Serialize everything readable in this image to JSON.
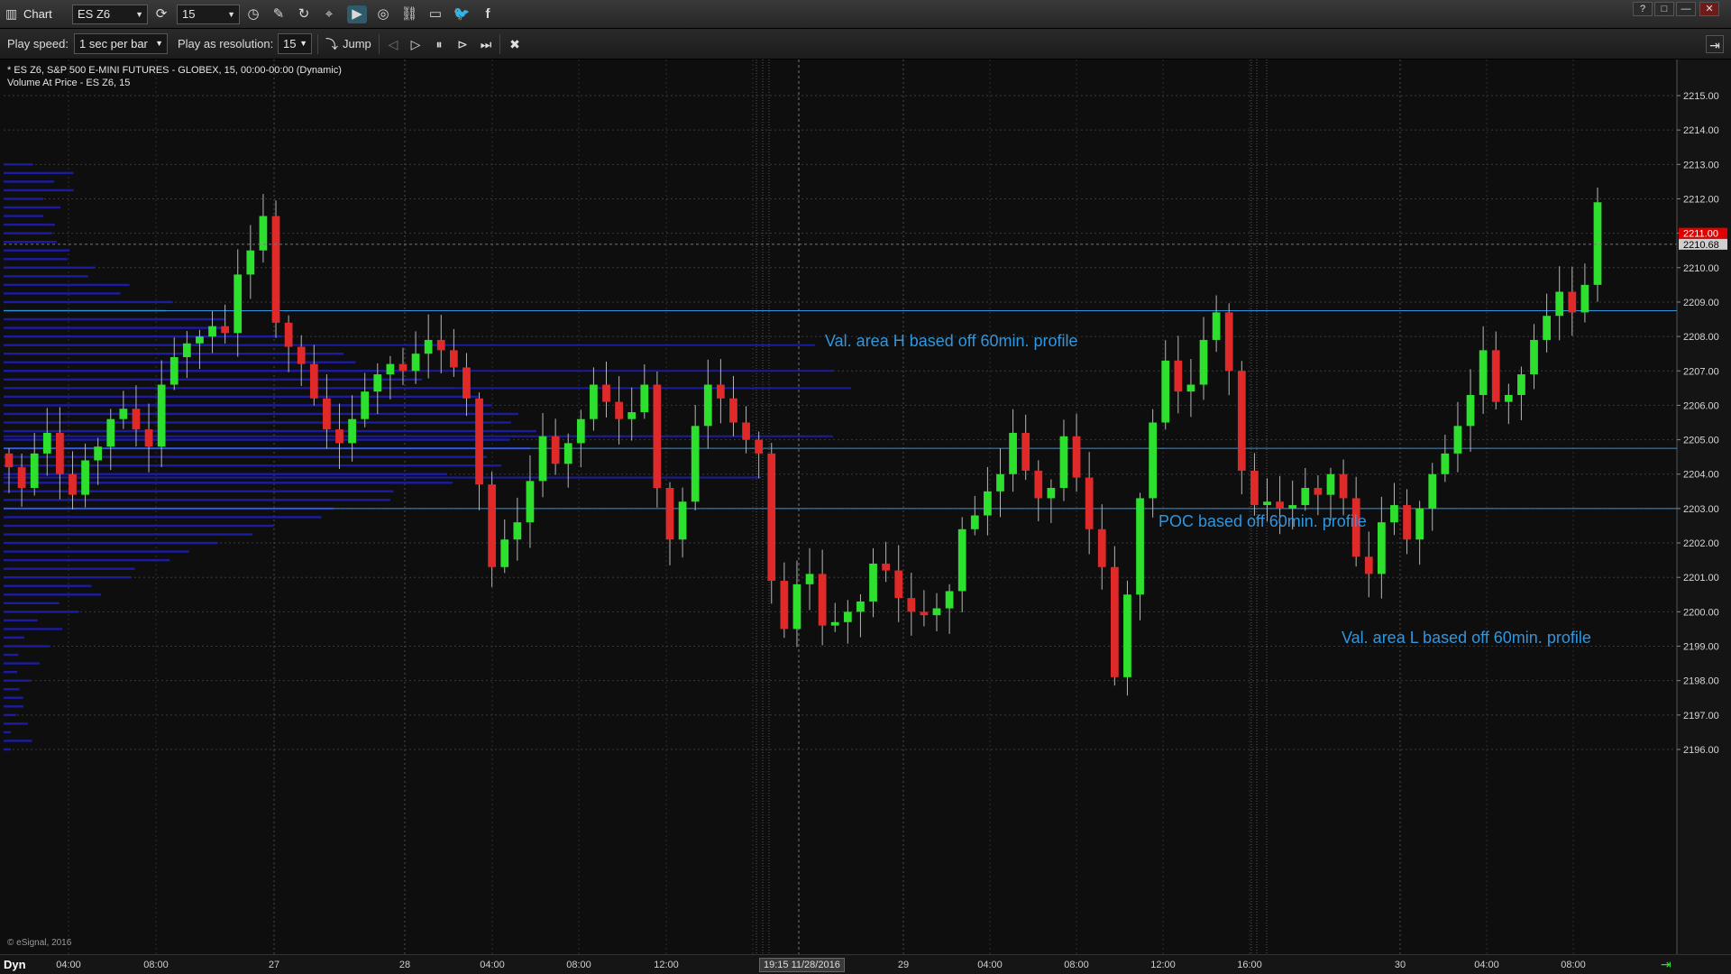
{
  "window": {
    "title": "Chart",
    "symbol": "ES Z6",
    "interval": "15",
    "buttons": [
      "?",
      "□",
      "—",
      "□",
      "✕"
    ]
  },
  "toolbar_icons": [
    "refresh-icon",
    "clock-icon",
    "pencil-icon",
    "cycle-icon",
    "cursor-icon",
    "replay-icon",
    "globe-icon",
    "link-icon",
    "comment-icon",
    "twitter-icon",
    "facebook-icon"
  ],
  "replay": {
    "play_speed_label": "Play speed:",
    "play_speed_value": "1 sec per bar",
    "resolution_label": "Play as resolution:",
    "resolution_value": "15",
    "jump_label": "Jump"
  },
  "chart": {
    "info_line1": "* ES Z6, S&P 500 E-MINI FUTURES - GLOBEX, 15, 00:00-00:00 (Dynamic)",
    "info_line2": "Volume At Price - ES Z6, 15",
    "copyright": "© eSignal, 2016",
    "last_price": "2211.00",
    "cursor_price": "2210.68",
    "cursor_time": "19:15 11/28/2016",
    "dyn_label": "Dyn",
    "annotations": {
      "val_area_high": "Val. area H based off 60min. profile",
      "poc": "POC based off 60min. profile",
      "val_area_low": "Val. area L based off 60min. profile"
    },
    "colors": {
      "up": "#2ee02e",
      "down": "#e02a2a",
      "profile": "#1c1ca0",
      "level_line": "#2f96e0",
      "last_price_bg": "#e00000"
    }
  },
  "chart_data": {
    "type": "candlestick",
    "symbol": "ES Z6",
    "interval_minutes": 15,
    "y_axis": {
      "min": 2195.5,
      "max": 2215.5,
      "ticks": [
        "2215.00",
        "2214.00",
        "2213.00",
        "2212.00",
        "2211.00",
        "2210.00",
        "2209.00",
        "2208.00",
        "2207.00",
        "2206.00",
        "2205.00",
        "2204.00",
        "2203.00",
        "2202.00",
        "2201.00",
        "2200.00",
        "2199.00",
        "2198.00",
        "2197.00",
        "2196.00"
      ]
    },
    "x_axis_ticks": [
      "04:00",
      "08:00",
      "27",
      "28",
      "04:00",
      "08:00",
      "12:00",
      "16:00",
      "29",
      "04:00",
      "08:00",
      "12:00",
      "16:00",
      "30",
      "04:00",
      "08:00"
    ],
    "levels": {
      "value_area_high": 2208.75,
      "poc": 2204.75,
      "value_area_low": 2203.0
    },
    "last_price": 2211.0,
    "close_path": [
      2204.2,
      2203.6,
      2204.6,
      2205.2,
      2204.0,
      2203.4,
      2204.4,
      2204.8,
      2205.6,
      2205.9,
      2205.3,
      2204.8,
      2206.6,
      2207.4,
      2207.8,
      2208.0,
      2208.3,
      2208.1,
      2209.8,
      2210.5,
      2211.5,
      2208.4,
      2207.7,
      2207.2,
      2206.2,
      2205.3,
      2204.9,
      2205.6,
      2206.4,
      2206.9,
      2207.2,
      2207.0,
      2207.5,
      2207.9,
      2207.6,
      2207.1,
      2206.2,
      2203.7,
      2201.3,
      2202.1,
      2202.6,
      2203.8,
      2205.1,
      2204.3,
      2204.9,
      2205.6,
      2206.6,
      2206.1,
      2205.6,
      2205.8,
      2206.6,
      2203.6,
      2202.1,
      2203.2,
      2205.4,
      2206.6,
      2206.2,
      2205.5,
      2205.0,
      2204.6,
      2200.9,
      2199.5,
      2200.8,
      2201.1,
      2199.6,
      2199.7,
      2200.0,
      2200.3,
      2201.4,
      2201.2,
      2200.4,
      2200.0,
      2199.9,
      2200.1,
      2200.6,
      2202.4,
      2202.8,
      2203.5,
      2204.0,
      2205.2,
      2204.1,
      2203.3,
      2203.6,
      2205.1,
      2203.9,
      2202.4,
      2201.3,
      2198.1,
      2200.5,
      2203.3,
      2205.5,
      2207.3,
      2206.4,
      2206.6,
      2207.9,
      2208.7,
      2207.0,
      2204.1,
      2203.1,
      2203.2,
      2203.0,
      2203.1,
      2203.6,
      2203.4,
      2204.0,
      2203.3,
      2201.6,
      2201.1,
      2202.6,
      2203.1,
      2202.1,
      2203.0,
      2204.0,
      2204.6,
      2205.4,
      2206.3,
      2207.6,
      2206.1,
      2206.3,
      2206.9,
      2207.9,
      2208.6,
      2209.3,
      2208.7,
      2209.5,
      2211.9
    ]
  }
}
